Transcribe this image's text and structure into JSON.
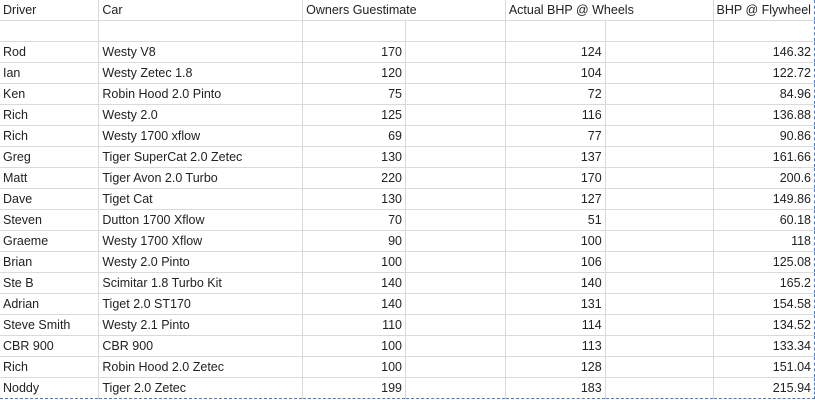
{
  "headers": {
    "driver": "Driver",
    "car": "Car",
    "guess": "Owners Guestimate",
    "wheels": "Actual BHP @ Wheels",
    "flywheel": "BHP @ Flywheel"
  },
  "rows": [
    {
      "driver": "Rod",
      "car": "Westy V8",
      "guess": "170",
      "wheels": "124",
      "flywheel": "146.32"
    },
    {
      "driver": "Ian",
      "car": "Westy Zetec 1.8",
      "guess": "120",
      "wheels": "104",
      "flywheel": "122.72"
    },
    {
      "driver": "Ken",
      "car": "Robin Hood 2.0 Pinto",
      "guess": "75",
      "wheels": "72",
      "flywheel": "84.96"
    },
    {
      "driver": "Rich",
      "car": "Westy 2.0",
      "guess": "125",
      "wheels": "116",
      "flywheel": "136.88"
    },
    {
      "driver": "Rich",
      "car": "Westy 1700 xflow",
      "guess": "69",
      "wheels": "77",
      "flywheel": "90.86"
    },
    {
      "driver": "Greg",
      "car": "Tiger SuperCat 2.0 Zetec",
      "guess": "130",
      "wheels": "137",
      "flywheel": "161.66"
    },
    {
      "driver": "Matt",
      "car": "Tiger Avon 2.0 Turbo",
      "guess": "220",
      "wheels": "170",
      "flywheel": "200.6"
    },
    {
      "driver": "Dave",
      "car": "Tiget Cat",
      "guess": "130",
      "wheels": "127",
      "flywheel": "149.86"
    },
    {
      "driver": "Steven",
      "car": "Dutton 1700 Xflow",
      "guess": "70",
      "wheels": "51",
      "flywheel": "60.18"
    },
    {
      "driver": "Graeme",
      "car": "Westy 1700 Xflow",
      "guess": "90",
      "wheels": "100",
      "flywheel": "118"
    },
    {
      "driver": "Brian",
      "car": "Westy 2.0 Pinto",
      "guess": "100",
      "wheels": "106",
      "flywheel": "125.08"
    },
    {
      "driver": "Ste B",
      "car": "Scimitar 1.8 Turbo Kit",
      "guess": "140",
      "wheels": "140",
      "flywheel": "165.2"
    },
    {
      "driver": "Adrian",
      "car": "Tiget 2.0 ST170",
      "guess": "140",
      "wheels": "131",
      "flywheel": "154.58"
    },
    {
      "driver": "Steve Smith",
      "car": "Westy 2.1 Pinto",
      "guess": "110",
      "wheels": "114",
      "flywheel": "134.52"
    },
    {
      "driver": "CBR 900",
      "car": "CBR 900",
      "guess": "100",
      "wheels": "113",
      "flywheel": "133.34"
    },
    {
      "driver": "Rich",
      "car": "Robin Hood 2.0 Zetec",
      "guess": "100",
      "wheels": "128",
      "flywheel": "151.04"
    },
    {
      "driver": "Noddy",
      "car": "Tiger 2.0 Zetec",
      "guess": "199",
      "wheels": "183",
      "flywheel": "215.94"
    }
  ]
}
